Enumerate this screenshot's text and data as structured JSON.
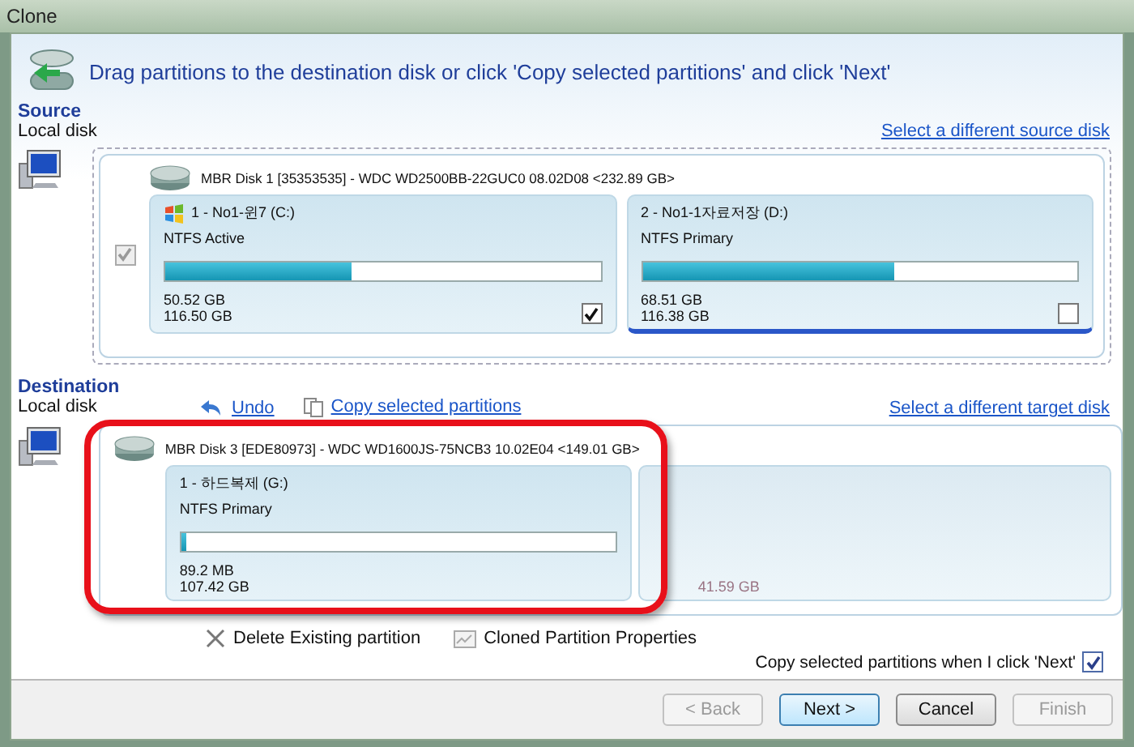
{
  "window": {
    "title": "Clone"
  },
  "header": {
    "text": "Drag partitions to the destination disk or click 'Copy selected partitions' and click 'Next'"
  },
  "source": {
    "heading": "Source",
    "subheading": "Local disk",
    "link": "Select a different source disk",
    "disk_checked": true,
    "disk": {
      "label": "MBR Disk 1 [35353535] - WDC WD2500BB-22GUC0 08.02D08  <232.89 GB>",
      "partitions": [
        {
          "kind": "system",
          "name": "1 - No1-윈7 (C:)",
          "fs": "NTFS Active",
          "level": 0.43,
          "used": "50.52 GB",
          "size": "116.50 GB",
          "checked": true,
          "focused": false
        },
        {
          "kind": "data",
          "name": "2 - No1-1자료저장 (D:)",
          "fs": "NTFS Primary",
          "level": 0.58,
          "used": "68.51 GB",
          "size": "116.38 GB",
          "checked": false,
          "focused": true
        }
      ]
    }
  },
  "destination": {
    "heading": "Destination",
    "subheading": "Local disk",
    "undo": "Undo",
    "copy": "Copy selected partitions",
    "link": "Select a different target disk",
    "disk": {
      "label": "MBR Disk 3 [EDE80973] - WDC WD1600JS-75NCB3 10.02E04  <149.01 GB>",
      "partitions": [
        {
          "kind": "data",
          "name": "1 - 하드복제 (G:)",
          "fs": "NTFS Primary",
          "level": 0.01,
          "used": "89.2 MB",
          "size": "107.42 GB"
        },
        {
          "kind": "unallocated",
          "size": "41.59 GB"
        }
      ]
    }
  },
  "actions": [
    "Delete Existing partition",
    "Cloned Partition Properties"
  ],
  "copy_on_next": {
    "label": "Copy selected partitions when I click 'Next'",
    "checked": true
  },
  "buttons": [
    {
      "label": "< Back",
      "disabled": true,
      "default": false
    },
    {
      "label": "Next >",
      "disabled": false,
      "default": true
    },
    {
      "label": "Cancel",
      "disabled": false,
      "default": false
    },
    {
      "label": "Finish",
      "disabled": true,
      "default": false
    }
  ]
}
